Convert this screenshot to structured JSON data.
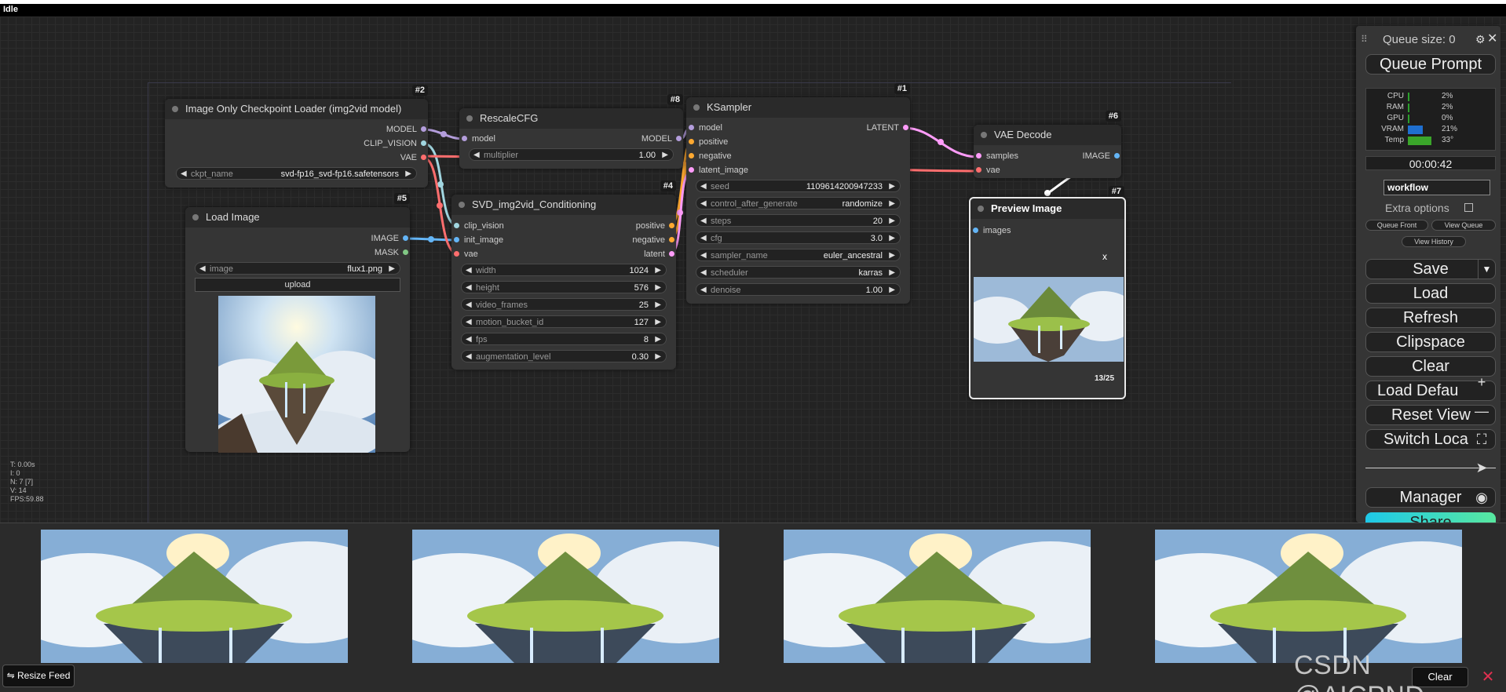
{
  "status": "Idle",
  "nodes": {
    "loader": {
      "badge": "#2",
      "title": "Image Only Checkpoint Loader (img2vid model)",
      "outputs": [
        "MODEL",
        "CLIP_VISION",
        "VAE"
      ],
      "widget": {
        "name": "ckpt_name",
        "value": "svd-fp16_svd-fp16.safetensors"
      }
    },
    "load_image": {
      "badge": "#5",
      "title": "Load Image",
      "outputs": [
        "IMAGE",
        "MASK"
      ],
      "widget": {
        "name": "image",
        "value": "flux1.png"
      },
      "upload_label": "upload"
    },
    "rescale": {
      "badge": "#8",
      "title": "RescaleCFG",
      "input": "model",
      "output": "MODEL",
      "widget": {
        "name": "multiplier",
        "value": "1.00"
      }
    },
    "svd": {
      "badge": "#4",
      "title": "SVD_img2vid_Conditioning",
      "inputs": [
        "clip_vision",
        "init_image",
        "vae"
      ],
      "outputs": [
        "positive",
        "negative",
        "latent"
      ],
      "widgets": [
        {
          "name": "width",
          "value": "1024"
        },
        {
          "name": "height",
          "value": "576"
        },
        {
          "name": "video_frames",
          "value": "25"
        },
        {
          "name": "motion_bucket_id",
          "value": "127"
        },
        {
          "name": "fps",
          "value": "8"
        },
        {
          "name": "augmentation_level",
          "value": "0.30"
        }
      ]
    },
    "ksampler": {
      "badge": "#1",
      "title": "KSampler",
      "inputs": [
        "model",
        "positive",
        "negative",
        "latent_image"
      ],
      "output": "LATENT",
      "widgets": [
        {
          "name": "seed",
          "value": "1109614200947233"
        },
        {
          "name": "control_after_generate",
          "value": "randomize"
        },
        {
          "name": "steps",
          "value": "20"
        },
        {
          "name": "cfg",
          "value": "3.0"
        },
        {
          "name": "sampler_name",
          "value": "euler_ancestral"
        },
        {
          "name": "scheduler",
          "value": "karras"
        },
        {
          "name": "denoise",
          "value": "1.00"
        }
      ]
    },
    "vae_decode": {
      "badge": "#6",
      "title": "VAE Decode",
      "inputs": [
        "samples",
        "vae"
      ],
      "output": "IMAGE"
    },
    "preview": {
      "badge": "#7",
      "title": "Preview Image",
      "input": "images",
      "close": "x",
      "counter": "13/25"
    }
  },
  "side_menu": {
    "queue_size": "Queue size: 0",
    "queue_prompt": "Queue Prompt",
    "monitor": [
      {
        "label": "CPU",
        "value": "2%",
        "fill": 0.02,
        "color": "#2ca02c"
      },
      {
        "label": "RAM",
        "value": "2%",
        "fill": 0.02,
        "color": "#2ca02c"
      },
      {
        "label": "GPU",
        "value": "0%",
        "fill": 0.0,
        "color": "#2ca02c"
      },
      {
        "label": "VRAM",
        "value": "21%",
        "fill": 0.21,
        "color": "#1f6fd0"
      },
      {
        "label": "Temp",
        "value": "33°",
        "fill": 0.33,
        "color": "#3aa52a"
      }
    ],
    "timer": "00:00:42",
    "workflow_name": "workflow",
    "extra_options": "Extra options",
    "queue_front": "Queue Front",
    "view_queue": "View Queue",
    "view_history": "View History",
    "save": "Save",
    "save_arrow": "▼",
    "load": "Load",
    "refresh": "Refresh",
    "clipspace": "Clipspace",
    "clear": "Clear",
    "load_default": "Load Defau",
    "reset_view": "Reset View",
    "switch_locale": "Switch Loca",
    "manager": "Manager",
    "share": "Share"
  },
  "canvas_tools": {
    "zoom_in": "+",
    "zoom_out": "—",
    "fit": "⛶",
    "locate": "➤",
    "toggle_links": "◉"
  },
  "stats": [
    "T: 0.00s",
    "I: 0",
    "N: 7 [7]",
    "V: 14",
    "FPS:59.88"
  ],
  "feed": {
    "resize_label": "Resize Feed",
    "resize_icon": "⇋",
    "clear_label": "Clear",
    "close_label": "✕",
    "watermark": "CSDN @AICPND"
  },
  "colors": {
    "model": "#b39ddb",
    "clip_vision": "#a1d6e0",
    "vae": "#ff6e6e",
    "image": "#64b5f6",
    "mask": "#81c784",
    "conditioning": "#ffa931",
    "latent": "#ff9cf9"
  }
}
